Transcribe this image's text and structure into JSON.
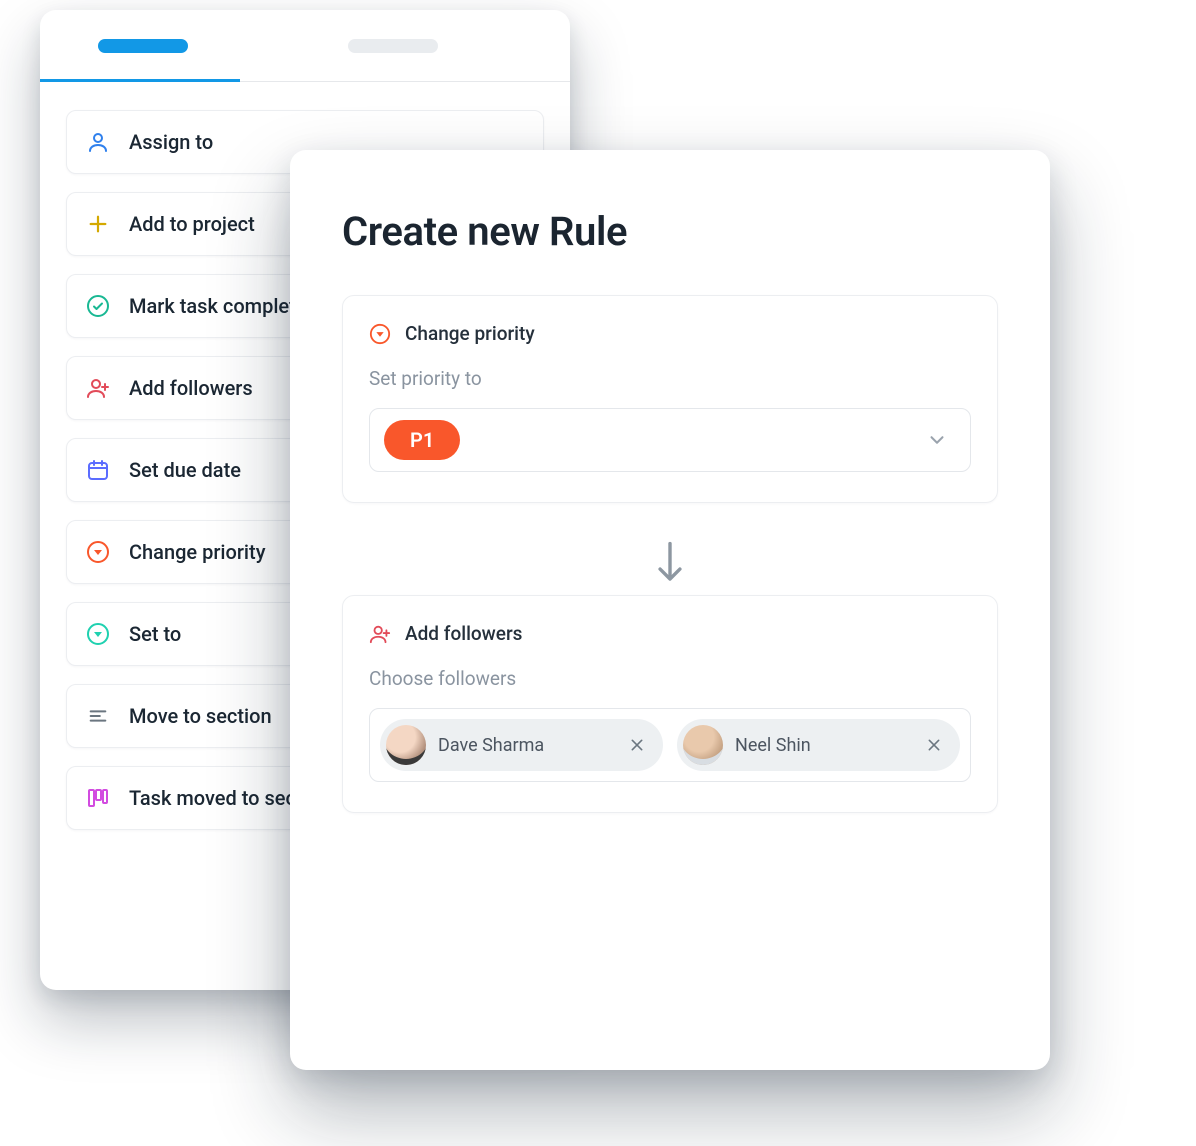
{
  "back_panel": {
    "actions": [
      {
        "key": "assign-to",
        "label": "Assign to",
        "icon": "user-icon",
        "color": "#2f80ed"
      },
      {
        "key": "add-to-project",
        "label": "Add to project",
        "icon": "plus-icon",
        "color": "#d4a900"
      },
      {
        "key": "mark-complete",
        "label": "Mark task complete",
        "icon": "check-circle-icon",
        "color": "#19b893"
      },
      {
        "key": "add-followers",
        "label": "Add followers",
        "icon": "user-plus-icon",
        "color": "#e24b59"
      },
      {
        "key": "set-due-date",
        "label": "Set due date",
        "icon": "calendar-icon",
        "color": "#5b6cff"
      },
      {
        "key": "change-priority",
        "label": "Change priority",
        "icon": "triangle-down-circle-icon",
        "color": "#f9572b"
      },
      {
        "key": "set-to",
        "label": "Set to",
        "icon": "triangle-down-circle-icon",
        "color": "#1fd1b0"
      },
      {
        "key": "move-to-section",
        "label": "Move to section",
        "icon": "lines-icon",
        "color": "#6b7680"
      },
      {
        "key": "task-moved",
        "label": "Task moved to section",
        "icon": "board-icon",
        "color": "#d24be0"
      }
    ]
  },
  "front_panel": {
    "title": "Create new Rule",
    "priority_card": {
      "header": "Change priority",
      "sub": "Set priority to",
      "value": "P1"
    },
    "followers_card": {
      "header": "Add followers",
      "sub": "Choose followers",
      "chips": [
        {
          "name": "Dave Sharma"
        },
        {
          "name": "Neel Shin"
        }
      ]
    }
  }
}
